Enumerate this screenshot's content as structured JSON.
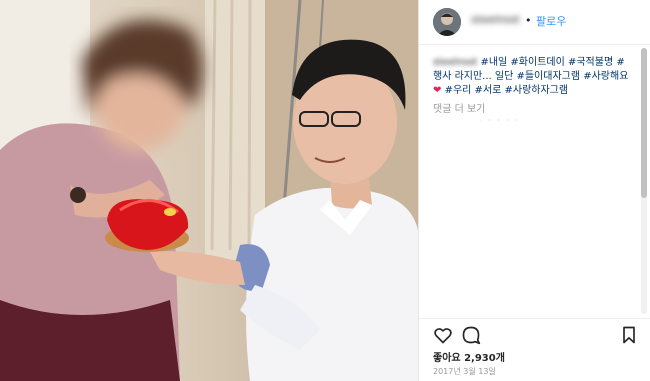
{
  "header": {
    "username": "steelroot",
    "separator": "•",
    "follow_label": "팔로우"
  },
  "caption": {
    "username": "steelroot",
    "text": "#내일 #화이트데이 #국적불명 #행사 라지만... 일단 #들이대자그램 #사랑해요",
    "heart": "❤",
    "text2": "#우리 #서로 #사랑하자그램"
  },
  "comments": {
    "more_label": "댓글 더 보기",
    "loading": "· · · · ·"
  },
  "post": {
    "likes": "좋아요 2,930개",
    "date": "2017년 3월 13일"
  },
  "icons": [
    "heart-icon",
    "comment-icon",
    "bookmark-icon"
  ],
  "colors": {
    "link": "#3897f0",
    "hashtag": "#003569",
    "border": "#e6e6e6",
    "muted": "#999999"
  }
}
